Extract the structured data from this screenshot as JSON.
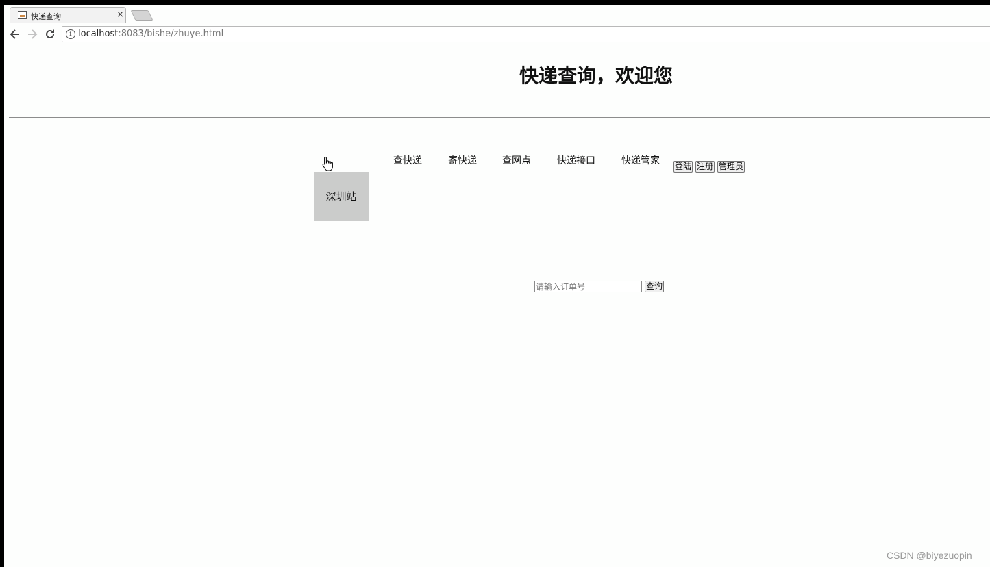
{
  "browser": {
    "tab_title": "快递查询",
    "tab_close": "×",
    "url_host": "localhost",
    "url_rest": ":8083/bishe/zhuye.html",
    "icons": {
      "back": "arrow-left-icon",
      "forward": "arrow-right-icon",
      "reload": "reload-icon",
      "info": "info-icon"
    }
  },
  "page": {
    "heading": "快递查询，欢迎您",
    "station": "深圳站",
    "nav": [
      "查快递",
      "寄快递",
      "查网点",
      "快递接口",
      "快递管家"
    ],
    "buttons": {
      "login": "登陆",
      "register": "注册",
      "admin": "管理员"
    },
    "search": {
      "placeholder": "请输入订单号",
      "value": "",
      "button": "查询"
    }
  },
  "watermark": "CSDN @biyezuopin"
}
